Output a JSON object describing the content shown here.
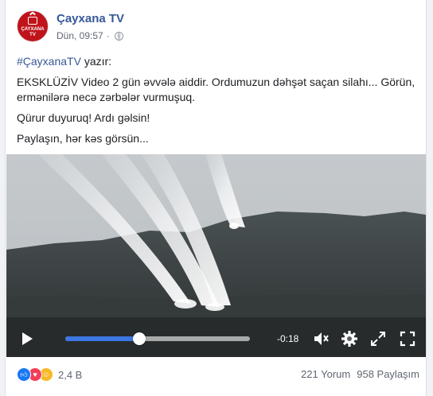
{
  "post": {
    "page_name": "Çayxana TV",
    "avatar_text": [
      "ÇAYXANA",
      "TV"
    ],
    "timestamp": "Dün, 09:57",
    "separator": "·",
    "hashtag": "#ÇayxanaTV",
    "after_hashtag": " yazır:",
    "paragraphs": [
      "EKSKLÜZİV Video 2 gün əvvələ aiddir. Ordumuzun dəhşət saçan silahı... Görün, ermənilərə necə zərbələr vurmuşuq.",
      "Qürur duyuruq! Ardı gəlsin!",
      "Paylaşın, hər kəs görsün..."
    ]
  },
  "video": {
    "time_remaining": "-0:18",
    "progress": 0.4,
    "icons": [
      "play-icon",
      "volume-icon",
      "settings-icon",
      "expand-icon",
      "fullscreen-icon"
    ]
  },
  "footer": {
    "reactions_count": "2,4 B",
    "comments": "221 Yorum",
    "shares": "958 Paylaşım"
  },
  "colors": {
    "link": "#365899",
    "progress": "#3b76e1",
    "like": "#1877f2",
    "love": "#f33e58",
    "care": "#f7b928",
    "avatar": "#c0141b"
  }
}
